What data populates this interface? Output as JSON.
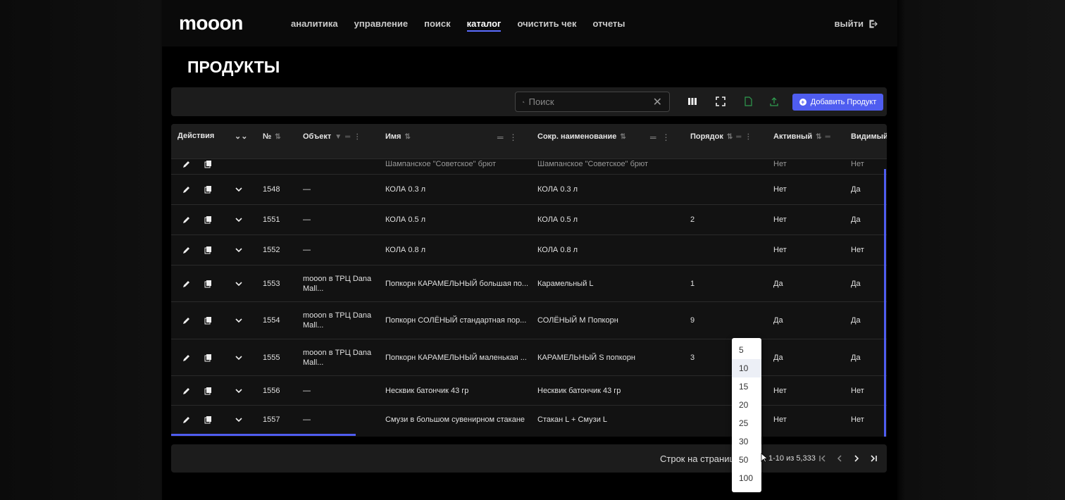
{
  "header": {
    "logo": "mooon",
    "nav": [
      "аналитика",
      "управление",
      "поиск",
      "каталог",
      "очистить чек",
      "отчеты"
    ],
    "active_nav": "каталог",
    "logout": "выйти"
  },
  "page": {
    "title": "ПРОДУКТЫ"
  },
  "toolbar": {
    "search_placeholder": "Поиск",
    "add_button": "Добавить Продукт"
  },
  "table": {
    "headers": {
      "actions": "Действия",
      "number": "№",
      "object": "Объект",
      "name": "Имя",
      "short_name": "Сокр. наименование",
      "order": "Порядок",
      "active": "Активный",
      "visible": "Видимый"
    },
    "partial_row": {
      "name": "Шампанское \"Советское\" брют",
      "short_name": "Шампанское \"Советское\" брют",
      "active": "Нет",
      "visible": "Нет"
    },
    "rows": [
      {
        "id": "1548",
        "object": "—",
        "name": "КОЛА 0.3 л",
        "short_name": "КОЛА 0.3 л",
        "order": "",
        "active": "Нет",
        "visible": "Да"
      },
      {
        "id": "1551",
        "object": "—",
        "name": "КОЛА 0.5 л",
        "short_name": "КОЛА 0.5 л",
        "order": "2",
        "active": "Нет",
        "visible": "Да"
      },
      {
        "id": "1552",
        "object": "—",
        "name": "КОЛА 0.8 л",
        "short_name": "КОЛА 0.8 л",
        "order": "",
        "active": "Нет",
        "visible": "Нет"
      },
      {
        "id": "1553",
        "object": "mooon в ТРЦ Dana Mall...",
        "name": "Попкорн КАРАМЕЛЬНЫЙ большая по...",
        "short_name": "Карамельный L",
        "order": "1",
        "active": "Да",
        "visible": "Да"
      },
      {
        "id": "1554",
        "object": "mooon в ТРЦ Dana Mall...",
        "name": "Попкорн СОЛЁНЫЙ стандартная пор...",
        "short_name": "СОЛЁНЫЙ М Попкорн",
        "order": "9",
        "active": "Да",
        "visible": "Да"
      },
      {
        "id": "1555",
        "object": "mooon в ТРЦ Dana Mall...",
        "name": "Попкорн КАРАМЕЛЬНЫЙ маленькая ...",
        "short_name": "КАРАМЕЛЬНЫЙ S попкорн",
        "order": "3",
        "active": "Да",
        "visible": "Да"
      },
      {
        "id": "1556",
        "object": "—",
        "name": "Несквик батончик 43 гр",
        "short_name": "Несквик батончик 43 гр",
        "order": "",
        "active": "Нет",
        "visible": "Нет"
      },
      {
        "id": "1557",
        "object": "—",
        "name": "Смузи в большом сувенирном стакане",
        "short_name": "Стакан L + Смузи L",
        "order": "",
        "active": "Нет",
        "visible": "Нет"
      }
    ]
  },
  "pagination": {
    "rows_per_page_label": "Строк на странице",
    "range": "1-10 из 5,333",
    "options": [
      "5",
      "10",
      "15",
      "20",
      "25",
      "30",
      "50",
      "100"
    ],
    "selected": "10"
  },
  "colors": {
    "accent": "#4f5df0",
    "background": "#000000",
    "panel": "#1c1c1c"
  }
}
